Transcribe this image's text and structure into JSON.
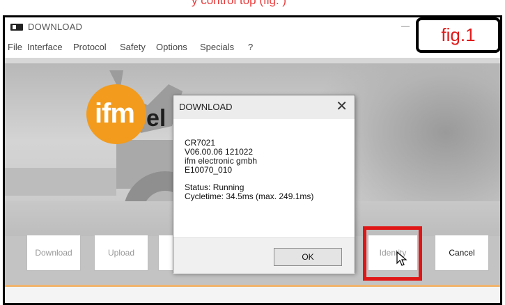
{
  "top_caption": "y control top (fig. )",
  "window": {
    "title": "DOWNLOAD",
    "minimize_icon": "minimize-icon"
  },
  "menu": [
    "File",
    "Interface",
    "Protocol",
    "Safety",
    "Options",
    "Specials",
    "?"
  ],
  "logo": {
    "text": "ifm",
    "word": "el",
    "color": "#f29b1c"
  },
  "buttons": {
    "download": "Download",
    "upload": "Upload",
    "identity": "Identity",
    "cancel": "Cancel"
  },
  "dialog": {
    "title": "DOWNLOAD",
    "lines": [
      "CR7021",
      "V06.00.06 121022",
      "ifm electronic gmbh",
      "E10070_010"
    ],
    "status": "Status: Running",
    "cycletime": "Cycletime: 34.5ms (max. 249.1ms)",
    "ok_label": "OK"
  },
  "fig_label": "fig.1",
  "colors": {
    "highlight": "#e01616",
    "fig_text": "#e21a1a",
    "accent_line": "#f0b46d"
  }
}
